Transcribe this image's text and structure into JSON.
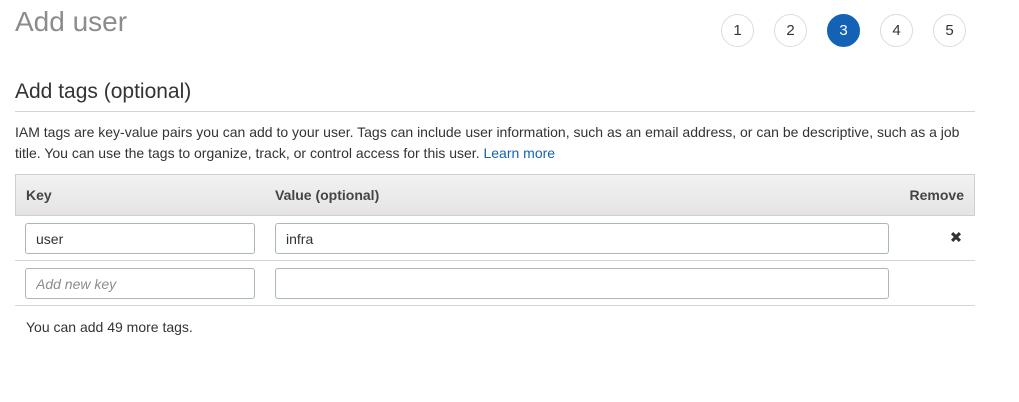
{
  "header": {
    "title": "Add user",
    "steps": [
      {
        "label": "1",
        "active": false
      },
      {
        "label": "2",
        "active": false
      },
      {
        "label": "3",
        "active": true
      },
      {
        "label": "4",
        "active": false
      },
      {
        "label": "5",
        "active": false
      }
    ]
  },
  "section": {
    "title": "Add tags (optional)",
    "description": "IAM tags are key-value pairs you can add to your user. Tags can include user information, such as an email address, or can be descriptive, such as a job title. You can use the tags to organize, track, or control access for this user.",
    "learn_more": "Learn more"
  },
  "table": {
    "columns": {
      "key": "Key",
      "value": "Value (optional)",
      "remove": "Remove"
    },
    "rows": [
      {
        "key": "user",
        "value": "infra",
        "removable": true
      }
    ],
    "new_row": {
      "key_placeholder": "Add new key",
      "value": ""
    }
  },
  "footer": {
    "remaining_text": "You can add 49 more tags."
  },
  "colors": {
    "accent": "#1462b5",
    "title_gray": "#8c8c8c"
  },
  "icons": {
    "remove": "close-x-icon"
  }
}
